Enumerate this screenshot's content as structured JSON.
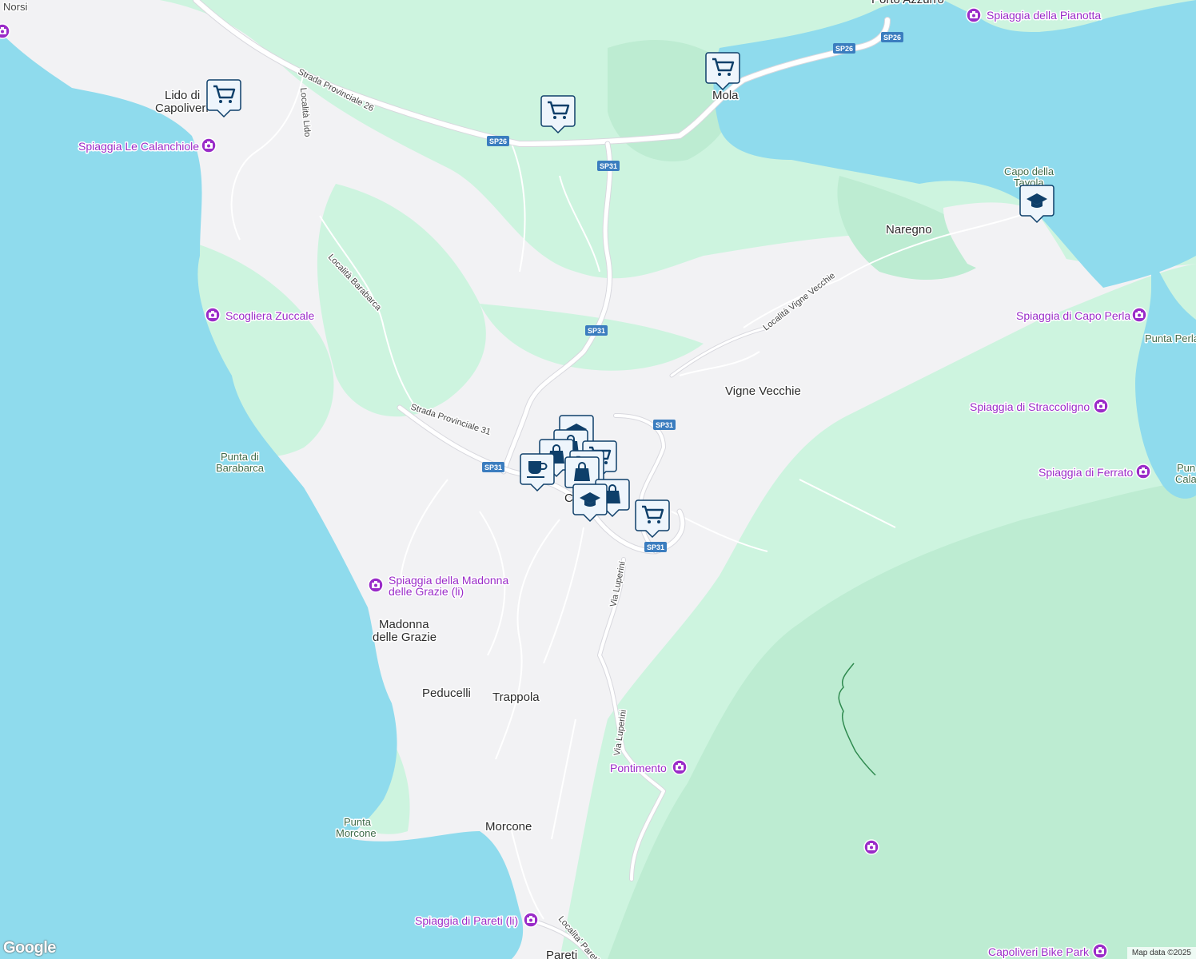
{
  "map": {
    "colors": {
      "water": "#8fdbed",
      "land": "#f2f2f4",
      "green": "#cdf4df",
      "darkgreen": "#bdecd2",
      "road": "#ffffff",
      "shield": "#3b7dbf",
      "poi": "#9a2bc8",
      "marker": "#0e3f6a"
    },
    "places": {
      "lido": "Lido di",
      "lido2": "Capoliveri",
      "mola": "Mola",
      "naregno": "Naregno",
      "vigne": "Vigne Vecchie",
      "madonna1": "Madonna",
      "madonna2": "delle Grazie",
      "peducelli": "Peducelli",
      "trappola": "Trappola",
      "morcone": "Morcone",
      "pareti": "Pareti",
      "norsi": "Norsi",
      "porto": "Porto Azzurro",
      "capol": "Ca"
    },
    "pois": {
      "pianotta": "Spiaggia della Pianotta",
      "calanchiole": "Spiaggia Le Calanchiole",
      "zuccale": "Scogliera Zuccale",
      "madonna1": "Spiaggia della Madonna",
      "madonna2": "delle Grazie (li)",
      "capoperla": "Spiaggia di Capo Perla",
      "straccoligno": "Spiaggia di Straccoligno",
      "ferrato": "Spiaggia di Ferrato",
      "pontimento": "Pontimento",
      "pareti": "Spiaggia di Pareti (li)",
      "bikepark": "Capoliveri Bike Park"
    },
    "naturals": {
      "capotavola1": "Capo della",
      "capotavola2": "Tavola",
      "barabarca1": "Punta di",
      "barabarca2": "Barabarca",
      "morcone1": "Punta",
      "morcone2": "Morcone",
      "puntaperla": "Punta Perla",
      "punta": "Pun",
      "cala": "Cala"
    },
    "roads": {
      "sp26": "Strada Provinciale 26",
      "sp31": "Strada Provinciale 31",
      "lido": "Località Lido",
      "barabarca": "Località Barabarca",
      "vigne": "Località Vigne Vecchie",
      "luperini1": "Via Luperini",
      "luperini2": "Via Luperini",
      "pareti": "Localita' Pareti"
    },
    "shields": {
      "a": "SP26",
      "b": "SP26",
      "c": "SP26",
      "d": "SP31",
      "e": "SP31",
      "f": "SP31",
      "g": "SP31",
      "h": "SP31"
    },
    "markers": {
      "cart": "shopping-cart-icon",
      "cap": "graduation-cap-icon",
      "cup": "coffee-cup-icon",
      "bag": "shopping-bag-icon"
    },
    "attribution": "Map data ©2025",
    "logo": "Google"
  }
}
